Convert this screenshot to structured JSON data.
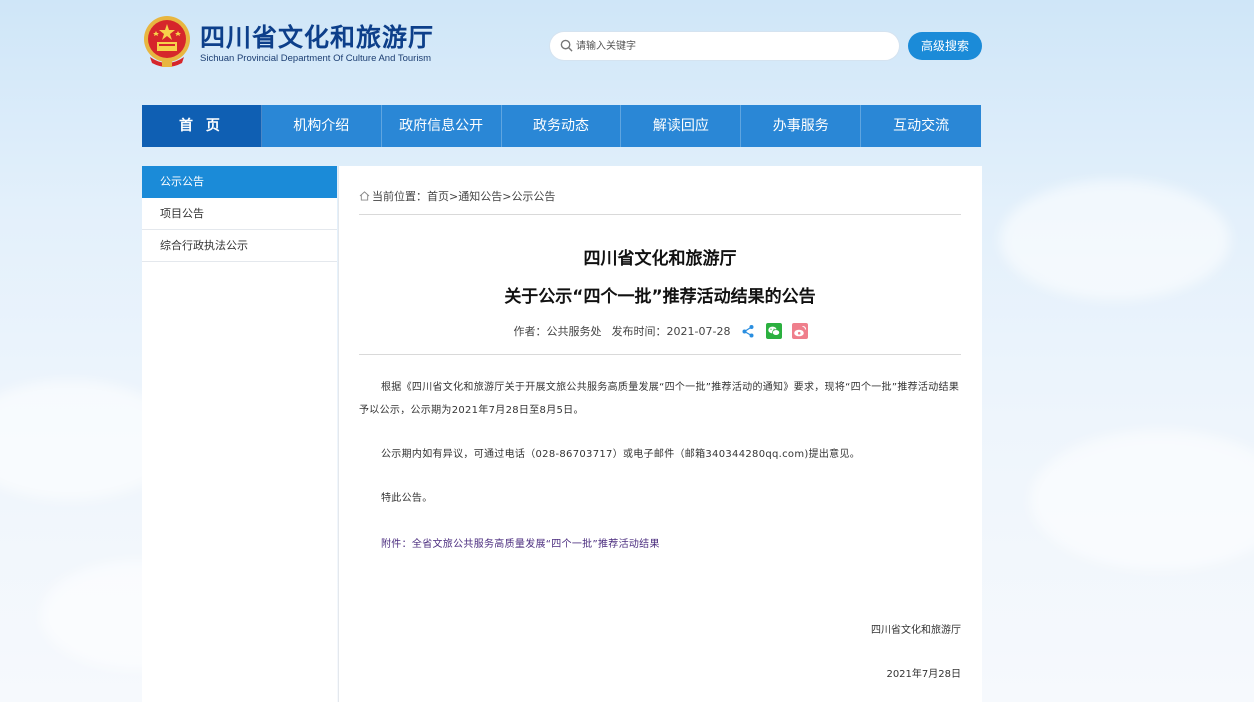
{
  "header": {
    "title": "四川省文化和旅游厅",
    "subtitle": "Sichuan Provincial Department Of Culture And Tourism",
    "search_placeholder": "请输入关键字",
    "advanced_search": "高级搜索"
  },
  "nav": {
    "items": [
      "首 页",
      "机构介绍",
      "政府信息公开",
      "政务动态",
      "解读回应",
      "办事服务",
      "互动交流"
    ]
  },
  "sidebar": {
    "items": [
      "公示公告",
      "项目公告",
      "综合行政执法公示"
    ]
  },
  "breadcrumb": {
    "label": "当前位置：",
    "home": "首页",
    "sep1": ">",
    "notices": "通知公告",
    "sep2": ">",
    "current": "公示公告"
  },
  "article": {
    "title_line1": "四川省文化和旅游厅",
    "title_line2": "关于公示“四个一批”推荐活动结果的公告",
    "author": "作者：公共服务处",
    "published": "发布时间：2021-07-28",
    "p1": "根据《四川省文化和旅游厅关于开展文旅公共服务高质量发展“四个一批”推荐活动的通知》要求，现将“四个一批”推荐活动结果予以公示，公示期为2021年7月28日至8月5日。",
    "p2": "公示期内如有异议，可通过电话（028-86703717）或电子邮件（邮箱340344280qq.com)提出意见。",
    "p3": "特此公告。",
    "attachment_label": "附件：",
    "attachment_link": "全省文旅公共服务高质量发展“四个一批”推荐活动结果",
    "signature_org": "四川省文化和旅游厅",
    "signature_date": "2021年7月28日"
  },
  "colors": {
    "nav_bg": "#2a87d6",
    "nav_active": "#0f5fb3",
    "accent": "#1b8bd8",
    "title_blue": "#0d3f8a"
  }
}
